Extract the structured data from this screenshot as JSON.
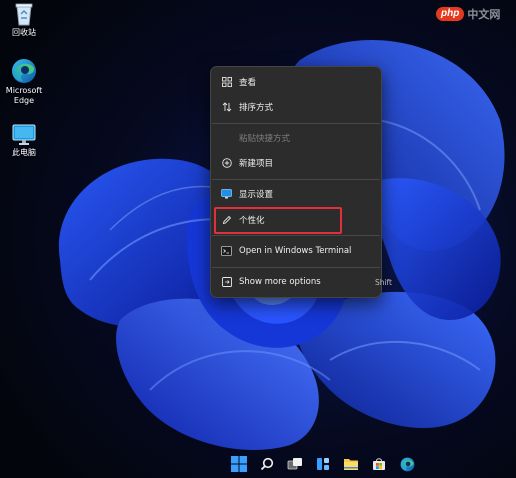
{
  "watermark": {
    "logo": "php",
    "text": "中文网"
  },
  "desktop_icons": [
    {
      "id": "recycle-bin",
      "label": "回收站"
    },
    {
      "id": "edge",
      "label": "Microsoft\nEdge"
    },
    {
      "id": "this-pc",
      "label": "此电脑"
    }
  ],
  "context_menu": {
    "items": [
      {
        "label": "查看",
        "icon": "grid-icon",
        "enabled": true
      },
      {
        "label": "排序方式",
        "icon": "sort-icon",
        "enabled": true
      },
      {
        "label": "粘贴快捷方式",
        "icon": "",
        "enabled": false
      },
      {
        "label": "新建项目",
        "icon": "plus-circle-icon",
        "enabled": true
      },
      {
        "label": "显示设置",
        "icon": "display-icon",
        "enabled": true
      },
      {
        "label": "个性化",
        "icon": "pencil-icon",
        "enabled": true,
        "highlighted": true
      },
      {
        "label": "Open in Windows Terminal",
        "icon": "terminal-icon",
        "enabled": true
      },
      {
        "label": "Show more options",
        "icon": "more-options-icon",
        "enabled": true,
        "shortcut": "Shift"
      }
    ]
  },
  "taskbar": {
    "icons": [
      "start-icon",
      "search-icon",
      "task-view-icon",
      "widgets-icon",
      "file-explorer-icon",
      "store-icon",
      "edge-icon"
    ]
  },
  "colors": {
    "highlight": "#e0313a",
    "menu_bg": "#2c2c2c",
    "wallpaper_blue": "#1f47f0"
  }
}
